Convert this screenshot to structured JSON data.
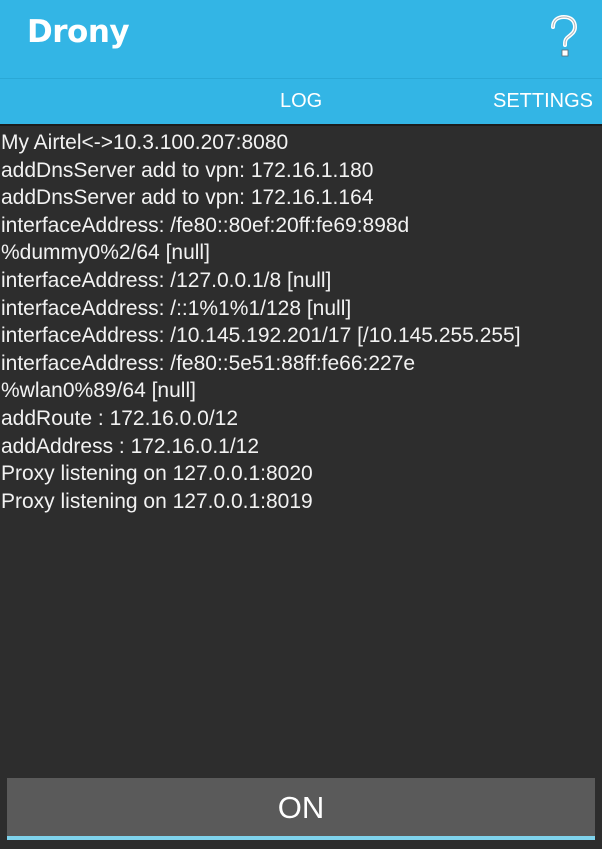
{
  "app": {
    "title": "Drony",
    "help_icon": "question-mark-icon",
    "accent_color": "#33b5e5"
  },
  "tabs": [
    {
      "label": "LOG",
      "selected": true
    },
    {
      "label": "SETTINGS",
      "selected": false
    }
  ],
  "log": {
    "lines": [
      "My Airtel<->10.3.100.207:8080",
      "addDnsServer add to vpn: 172.16.1.180",
      "addDnsServer add to vpn: 172.16.1.164",
      "interfaceAddress: /fe80::80ef:20ff:fe69:898d",
      "%dummy0%2/64 [null]",
      "interfaceAddress: /127.0.0.1/8 [null]",
      "interfaceAddress: /::1%1%1/128 [null]",
      "interfaceAddress: /10.145.192.201/17 [/10.145.255.255]",
      "interfaceAddress: /fe80::5e51:88ff:fe66:227e",
      "%wlan0%89/64 [null]",
      "addRoute : 172.16.0.0/12",
      "addAddress : 172.16.0.1/12",
      "Proxy listening on 127.0.0.1:8020",
      "Proxy listening on 127.0.0.1:8019"
    ]
  },
  "toggle": {
    "label": "ON"
  }
}
